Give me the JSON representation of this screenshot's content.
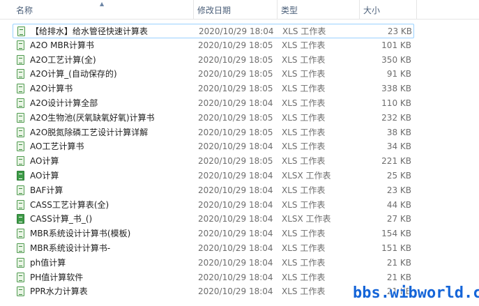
{
  "columns": {
    "name": "名称",
    "date": "修改日期",
    "type": "类型",
    "size": "大小"
  },
  "files": [
    {
      "name": "【给排水】给水管径快速计算表",
      "date": "2020/10/29 18:04",
      "type": "XLS 工作表",
      "size": "23 KB",
      "icon": "xls-file-icon"
    },
    {
      "name": "A2O MBR计算书",
      "date": "2020/10/29 18:05",
      "type": "XLS 工作表",
      "size": "101 KB",
      "icon": "xls-file-icon"
    },
    {
      "name": "A2O工艺计算(全)",
      "date": "2020/10/29 18:05",
      "type": "XLS 工作表",
      "size": "350 KB",
      "icon": "xls-file-icon"
    },
    {
      "name": "A2O计算_(自动保存的)",
      "date": "2020/10/29 18:05",
      "type": "XLS 工作表",
      "size": "91 KB",
      "icon": "xls-file-icon"
    },
    {
      "name": "A2O计算书",
      "date": "2020/10/29 18:05",
      "type": "XLS 工作表",
      "size": "338 KB",
      "icon": "xls-file-icon"
    },
    {
      "name": "A2O设计计算全部",
      "date": "2020/10/29 18:04",
      "type": "XLS 工作表",
      "size": "110 KB",
      "icon": "xls-file-icon"
    },
    {
      "name": "A2O生物池(厌氧缺氧好氧)计算书",
      "date": "2020/10/29 18:05",
      "type": "XLS 工作表",
      "size": "232 KB",
      "icon": "xls-file-icon"
    },
    {
      "name": "A2O脱氮除磷工艺设计计算详解",
      "date": "2020/10/29 18:05",
      "type": "XLS 工作表",
      "size": "38 KB",
      "icon": "xls-file-icon"
    },
    {
      "name": "AO工艺计算书",
      "date": "2020/10/29 18:04",
      "type": "XLS 工作表",
      "size": "34 KB",
      "icon": "xls-file-icon"
    },
    {
      "name": "AO计算",
      "date": "2020/10/29 18:05",
      "type": "XLS 工作表",
      "size": "221 KB",
      "icon": "xls-file-icon"
    },
    {
      "name": "AO计算",
      "date": "2020/10/29 18:04",
      "type": "XLSX 工作表",
      "size": "25 KB",
      "icon": "xlsx-file-icon"
    },
    {
      "name": "BAF计算",
      "date": "2020/10/29 18:04",
      "type": "XLS 工作表",
      "size": "23 KB",
      "icon": "xls-file-icon"
    },
    {
      "name": "CASS工艺计算表(全)",
      "date": "2020/10/29 18:04",
      "type": "XLS 工作表",
      "size": "44 KB",
      "icon": "xls-file-icon"
    },
    {
      "name": "CASS计算_书_()",
      "date": "2020/10/29 18:04",
      "type": "XLSX 工作表",
      "size": "27 KB",
      "icon": "xlsx-file-icon"
    },
    {
      "name": "MBR系统设计计算书(模板)",
      "date": "2020/10/29 18:04",
      "type": "XLS 工作表",
      "size": "154 KB",
      "icon": "xls-file-icon"
    },
    {
      "name": "MBR系统设计计算书-",
      "date": "2020/10/29 18:04",
      "type": "XLS 工作表",
      "size": "151 KB",
      "icon": "xls-file-icon"
    },
    {
      "name": "ph值计算",
      "date": "2020/10/29 18:04",
      "type": "XLS 工作表",
      "size": "21 KB",
      "icon": "xls-file-icon"
    },
    {
      "name": "PH值计算软件",
      "date": "2020/10/29 18:04",
      "type": "XLS 工作表",
      "size": "21 KB",
      "icon": "xls-file-icon"
    },
    {
      "name": "PPR水力计算表",
      "date": "2020/10/29 18:04",
      "type": "XLS 工作表",
      "size": "21 KB",
      "icon": "xls-file-icon"
    }
  ],
  "watermark": "bbs.wibworld.com"
}
